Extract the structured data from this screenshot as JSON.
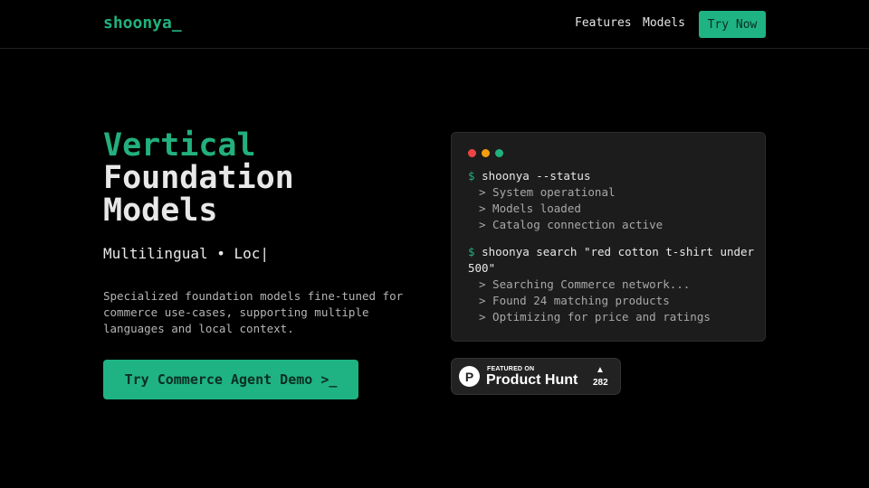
{
  "nav": {
    "logo": "shoonya_",
    "links": [
      {
        "label": "Features"
      },
      {
        "label": "Models"
      }
    ],
    "cta_label": "Try Now"
  },
  "hero": {
    "title_accent": "Vertical",
    "title_line2": "Foundation",
    "title_line3": "Models",
    "typing_text": "Multilingual • Loc|",
    "description": "Specialized foundation models fine-tuned for commerce use-cases, supporting multiple languages and local context.",
    "cta_label": "Try Commerce Agent Demo >_"
  },
  "terminal": {
    "blocks": [
      {
        "prompt": "$",
        "command": "shoonya --status",
        "outputs": [
          "> System operational",
          "> Models loaded",
          "> Catalog connection active"
        ]
      },
      {
        "prompt": "$",
        "command": "shoonya search \"red cotton t-shirt under 500\"",
        "outputs": [
          "> Searching Commerce network...",
          "> Found 24 matching products",
          "> Optimizing for price and ratings"
        ]
      }
    ]
  },
  "product_hunt": {
    "logo_letter": "P",
    "featured_label": "FEATURED ON",
    "name": "Product Hunt",
    "arrow": "▲",
    "count": "282"
  },
  "colors": {
    "accent": "#22b07d",
    "button": "#1fb383",
    "background": "#000000"
  }
}
